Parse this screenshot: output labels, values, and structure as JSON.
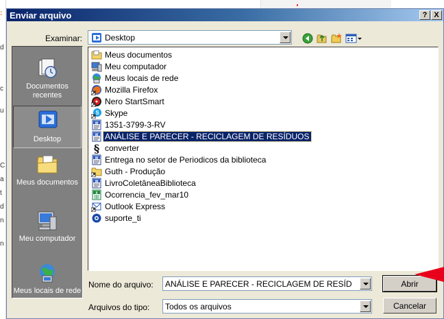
{
  "dialog": {
    "title": "Enviar arquivo",
    "help_button": "?",
    "close_button": "X"
  },
  "lookin": {
    "label": "Examinar:",
    "value": "Desktop"
  },
  "places": [
    {
      "label": "Documentos recentes",
      "icon": "recent-documents-icon"
    },
    {
      "label": "Desktop",
      "icon": "desktop-icon",
      "selected": true
    },
    {
      "label": "Meus documentos",
      "icon": "my-documents-icon"
    },
    {
      "label": "Meu computador",
      "icon": "my-computer-icon"
    },
    {
      "label": "Meus locais de rede",
      "icon": "network-places-icon"
    }
  ],
  "files": [
    {
      "name": "Meus documentos",
      "icon": "folder-icon"
    },
    {
      "name": "Meu computador",
      "icon": "computer-icon"
    },
    {
      "name": "Meus locais de rede",
      "icon": "network-icon"
    },
    {
      "name": "Mozilla Firefox",
      "icon": "firefox-shortcut-icon"
    },
    {
      "name": "Nero StartSmart",
      "icon": "nero-shortcut-icon"
    },
    {
      "name": "Skype",
      "icon": "skype-shortcut-icon"
    },
    {
      "name": "1351-3799-3-RV",
      "icon": "word-document-icon"
    },
    {
      "name": "ANÁLISE E PARECER - RECICLAGEM DE RESÍDUOS",
      "icon": "word-document-icon",
      "selected": true
    },
    {
      "name": "converter",
      "icon": "converter-icon"
    },
    {
      "name": "Entrega no setor de Periodicos da biblioteca",
      "icon": "word-document-icon"
    },
    {
      "name": "Guth - Produção",
      "icon": "folder-shortcut-icon"
    },
    {
      "name": "LivroColetâneaBiblioteca",
      "icon": "word-document-icon"
    },
    {
      "name": "Ocorrencia_fev_mar10",
      "icon": "excel-document-icon"
    },
    {
      "name": "Outlook Express",
      "icon": "outlook-shortcut-icon"
    },
    {
      "name": "suporte_ti",
      "icon": "app-shortcut-icon"
    }
  ],
  "filename": {
    "label": "Nome do arquivo:",
    "value": "ANÁLISE E PARECER - RECICLAGEM DE RESÍD"
  },
  "filetype": {
    "label": "Arquivos do tipo:",
    "value": "Todos os arquivos"
  },
  "buttons": {
    "open": "Abrir",
    "cancel": "Cancelar"
  },
  "colors": {
    "titlebar": "#0a246a",
    "selection": "#0a246a",
    "dialog_bg": "#ece9d8",
    "places_bg": "#808080",
    "annotation_arrow": "#e8001c"
  }
}
